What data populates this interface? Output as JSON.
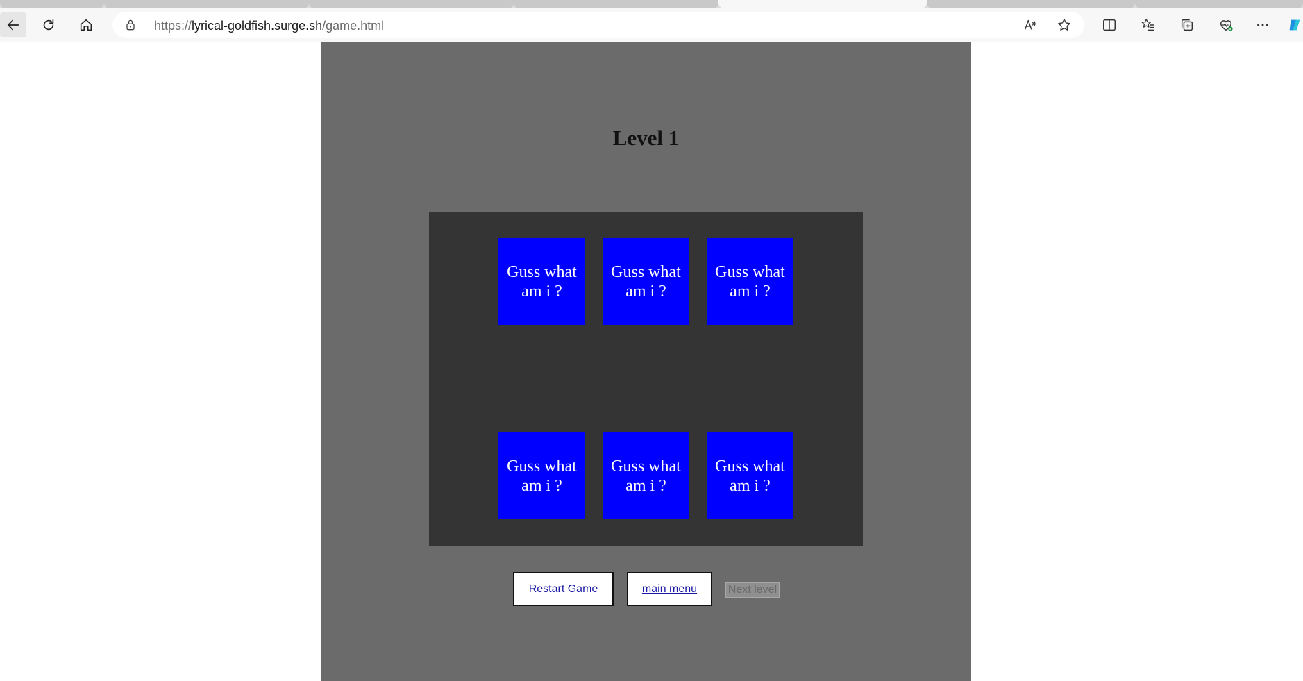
{
  "browser": {
    "url_scheme": "https://",
    "url_host": "lyrical-goldfish.surge.sh",
    "url_path": "/game.html"
  },
  "game": {
    "level_title": "Level 1",
    "cards": [
      {
        "label": "Guss what am i ?"
      },
      {
        "label": "Guss what am i ?"
      },
      {
        "label": "Guss what am i ?"
      },
      {
        "label": "Guss what am i ?"
      },
      {
        "label": "Guss what am i ?"
      },
      {
        "label": "Guss what am i ?"
      }
    ],
    "buttons": {
      "restart": "Restart Game",
      "main_menu": "main menu",
      "next_level": "Next level"
    }
  },
  "colors": {
    "panel": "#6b6b6b",
    "board": "#343434",
    "card": "#0000ff"
  }
}
